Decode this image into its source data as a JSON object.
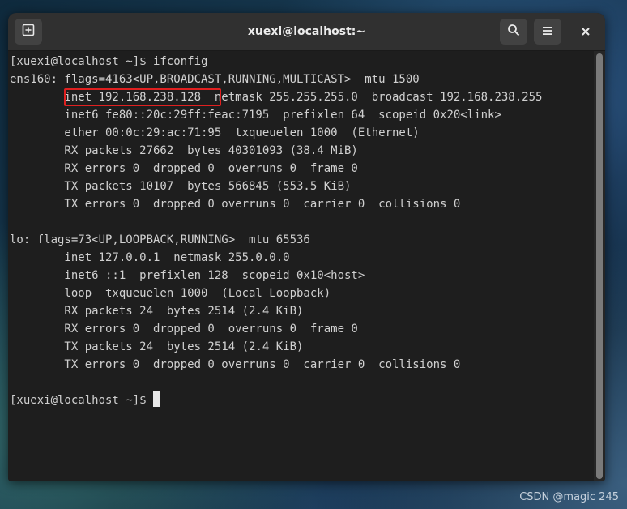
{
  "window": {
    "title": "xuexi@localhost:~"
  },
  "titlebar_icons": {
    "new_tab": "new-tab-icon",
    "search": "search-icon",
    "menu": "hamburger-menu-icon",
    "close": "close-icon"
  },
  "terminal": {
    "lines": [
      "[xuexi@localhost ~]$ ifconfig",
      "ens160: flags=4163<UP,BROADCAST,RUNNING,MULTICAST>  mtu 1500",
      "        inet 192.168.238.128  netmask 255.255.255.0  broadcast 192.168.238.255",
      "        inet6 fe80::20c:29ff:feac:7195  prefixlen 64  scopeid 0x20<link>",
      "        ether 00:0c:29:ac:71:95  txqueuelen 1000  (Ethernet)",
      "        RX packets 27662  bytes 40301093 (38.4 MiB)",
      "        RX errors 0  dropped 0  overruns 0  frame 0",
      "        TX packets 10107  bytes 566845 (553.5 KiB)",
      "        TX errors 0  dropped 0 overruns 0  carrier 0  collisions 0",
      "",
      "lo: flags=73<UP,LOOPBACK,RUNNING>  mtu 65536",
      "        inet 127.0.0.1  netmask 255.0.0.0",
      "        inet6 ::1  prefixlen 128  scopeid 0x10<host>",
      "        loop  txqueuelen 1000  (Local Loopback)",
      "        RX packets 24  bytes 2514 (2.4 KiB)",
      "        RX errors 0  dropped 0  overruns 0  frame 0",
      "        TX packets 24  bytes 2514 (2.4 KiB)",
      "        TX errors 0  dropped 0 overruns 0  carrier 0  collisions 0",
      "",
      "[xuexi@localhost ~]$ "
    ]
  },
  "colors": {
    "highlight_box": "#e02020",
    "terminal_bg": "#1e1e1e",
    "terminal_fg": "#d0d0d0"
  },
  "watermark": "CSDN @magic 245"
}
